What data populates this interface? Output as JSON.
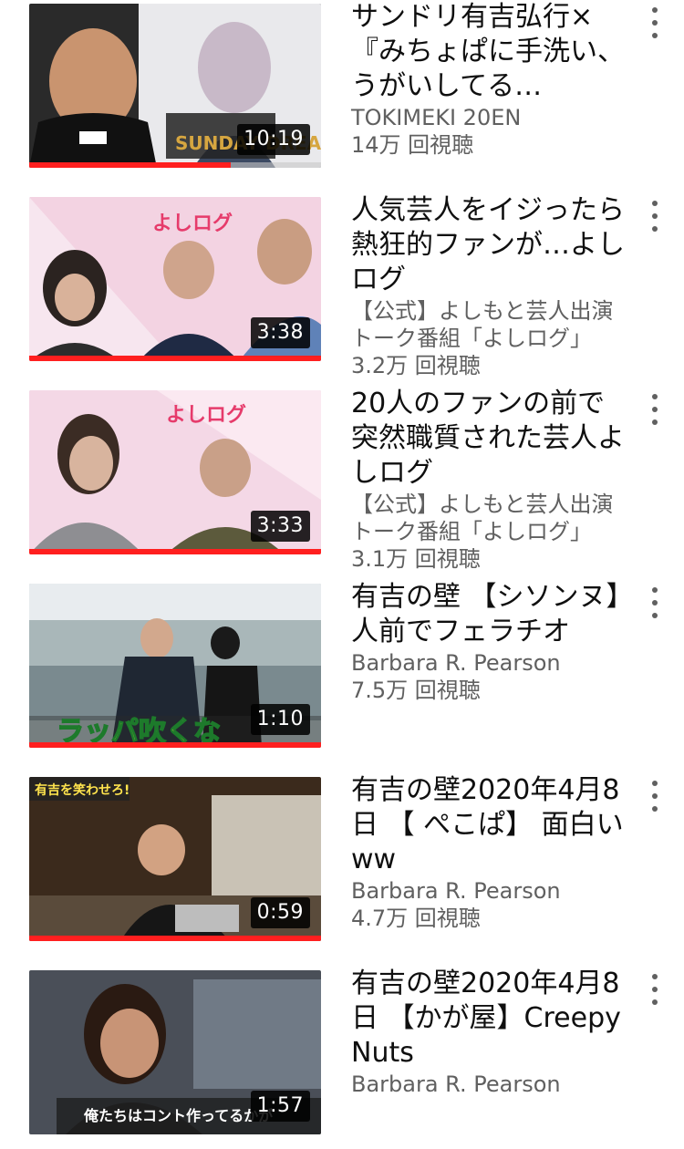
{
  "videos": [
    {
      "title": "サンドリ有吉弘行×『みちょぱに手洗い、うがいしてる…",
      "channel": "TOKIMEKI 20EN",
      "views": "14万 回視聴",
      "duration": "10:19",
      "watched_fraction": 0.69,
      "thumb_caption": "SUNDAY DREAM"
    },
    {
      "title": "人気芸人をイジったら熱狂的ファンが…よしログ",
      "channel": "【公式】よしもと芸人出演トーク番組「よしログ」",
      "views": "3.2万 回視聴",
      "duration": "3:38",
      "watched_fraction": 1.0,
      "thumb_caption": "よしログ"
    },
    {
      "title": "20人のファンの前で突然職質された芸人よしログ",
      "channel": "【公式】よしもと芸人出演トーク番組「よしログ」",
      "views": "3.1万 回視聴",
      "duration": "3:33",
      "watched_fraction": 1.0,
      "thumb_caption": "よしログ"
    },
    {
      "title": "有吉の壁 【シソンヌ】人前でフェラチオ",
      "channel": "Barbara R. Pearson",
      "views": "7.5万 回視聴",
      "duration": "1:10",
      "watched_fraction": 1.0,
      "thumb_caption": "ラッパ吹くな"
    },
    {
      "title": "有吉の壁2020年4月8日 【 ぺこぱ】 面白いww",
      "channel": "Barbara R. Pearson",
      "views": "4.7万 回視聴",
      "duration": "0:59",
      "watched_fraction": 1.0,
      "thumb_caption": "有吉を笑わせろ!"
    },
    {
      "title": "有吉の壁2020年4月8日 【かが屋】Creepy Nuts",
      "channel": "Barbara R. Pearson",
      "views": "",
      "duration": "1:57",
      "watched_fraction": 0,
      "thumb_caption": "俺たちはコント作ってるかが"
    }
  ],
  "colors": {
    "progress": "#ff1f1f",
    "secondary_text": "#606060",
    "primary_text": "#0f0f0f"
  },
  "icons": {
    "menu": "more-vert-icon"
  }
}
